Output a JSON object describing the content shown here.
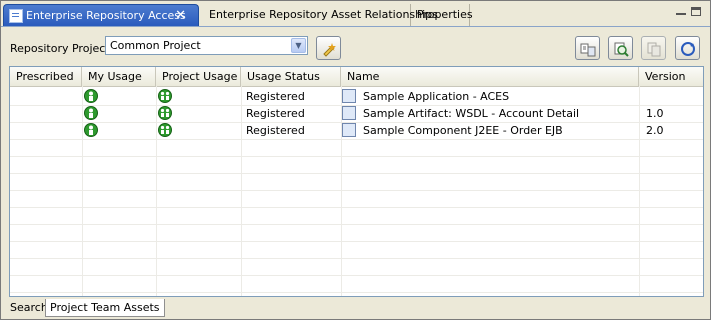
{
  "tabs": [
    {
      "label": "Enterprise Repository Access",
      "active": true,
      "icon": "repository-view-icon"
    },
    {
      "label": "Enterprise Repository Asset Relationships",
      "active": false
    },
    {
      "label": "Properties",
      "active": false
    }
  ],
  "close_glyph": "✕",
  "toolbar": {
    "repo_label": "Repository Project",
    "repo_value": "Common Project",
    "buttons": [
      "edit-project-icon",
      "submit-asset-icon",
      "search-asset-icon",
      "copy-asset-icon",
      "refresh-icon"
    ]
  },
  "table": {
    "columns": [
      "Prescribed",
      "My Usage",
      "Project Usage",
      "Usage Status",
      "Name",
      "Version"
    ],
    "rows": [
      {
        "prescribed": "",
        "my_usage_icon": "user-usage-icon",
        "project_usage_icon": "project-usage-icon",
        "status": "Registered",
        "name": "Sample Application - ACES",
        "version": ""
      },
      {
        "prescribed": "",
        "my_usage_icon": "user-usage-icon",
        "project_usage_icon": "project-usage-icon",
        "status": "Registered",
        "name": "Sample Artifact: WSDL - Account Detail",
        "version": "1.0"
      },
      {
        "prescribed": "",
        "my_usage_icon": "user-usage-icon",
        "project_usage_icon": "project-usage-icon",
        "status": "Registered",
        "name": "Sample Component J2EE - Order EJB",
        "version": "2.0"
      }
    ]
  },
  "bottom_tabs": [
    {
      "label": "Search",
      "active": false
    },
    {
      "label": "Project Team Assets",
      "active": true
    }
  ],
  "colors": {
    "active_tab": "#2a5bbd",
    "panel": "#ece9d8",
    "usage_green": "#2e9a2e"
  }
}
